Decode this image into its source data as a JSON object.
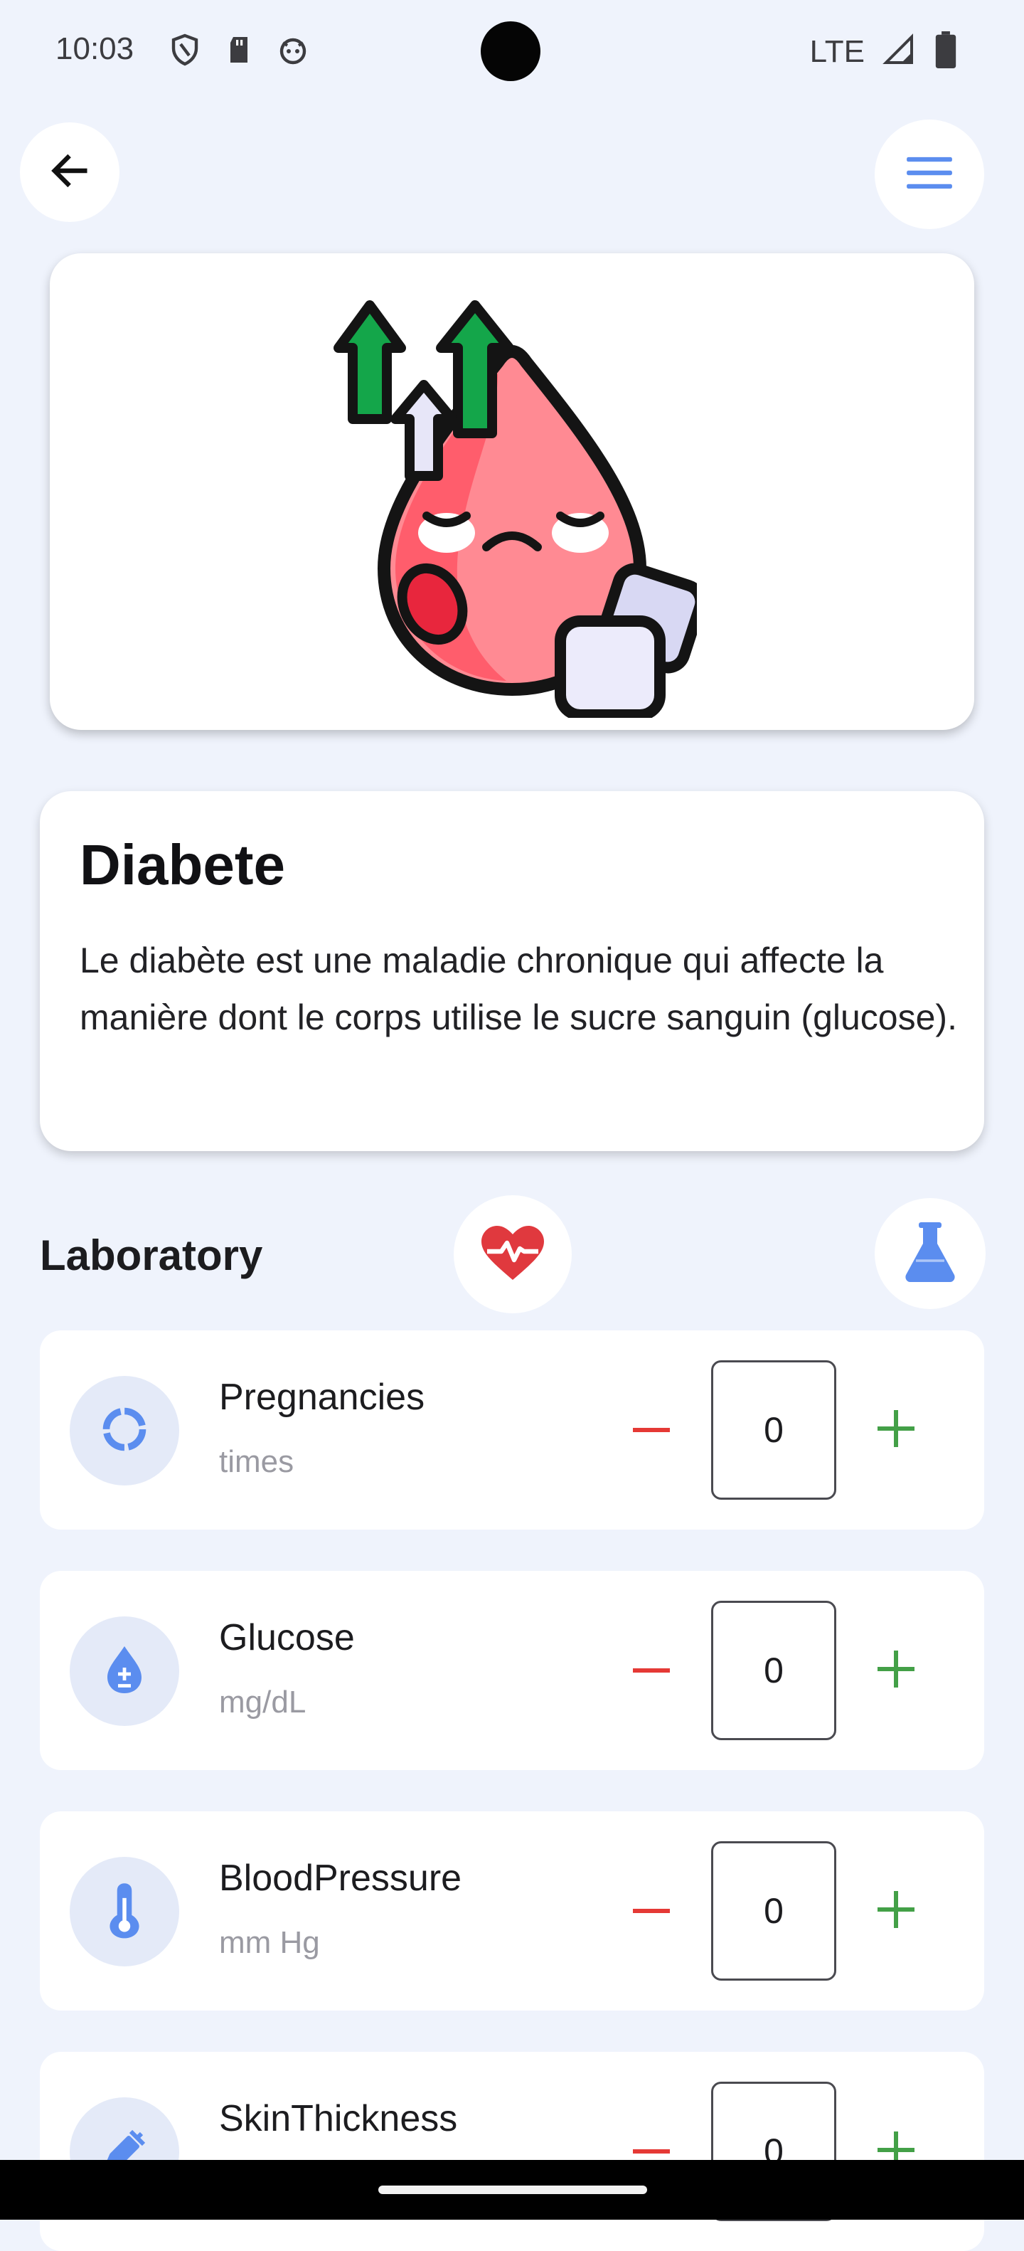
{
  "status_bar": {
    "time": "10:03",
    "network": "LTE",
    "icons": [
      "shield-icon",
      "sd-card-icon",
      "android-icon",
      "signal-icon",
      "battery-icon"
    ]
  },
  "header": {
    "back_icon": "arrow-left-icon",
    "menu_icon": "hamburger-menu-icon"
  },
  "hero": {
    "illustration": "blood-drop-sugar-icon"
  },
  "disease": {
    "title": "Diabete",
    "description": "Le diabète est une maladie chronique qui affecte la manière dont le corps utilise le sucre sanguin (glucose)."
  },
  "laboratory": {
    "title": "Laboratory",
    "heart_icon": "heart-pulse-icon",
    "flask_icon": "flask-icon",
    "items": [
      {
        "name": "Pregnancies",
        "unit": "times",
        "value": "0",
        "icon": "circle-progress-icon"
      },
      {
        "name": "Glucose",
        "unit": "mg/dL",
        "value": "0",
        "icon": "drop-plus-minus-icon"
      },
      {
        "name": "BloodPressure",
        "unit": "mm Hg",
        "value": "0",
        "icon": "thermometer-icon"
      },
      {
        "name": "SkinThickness",
        "unit": "",
        "value": "0",
        "icon": "syringe-icon"
      }
    ]
  },
  "colors": {
    "background": "#eff3fc",
    "accent_blue": "#5b8def",
    "minus_red": "#e53935",
    "plus_green": "#43a047",
    "heart_red": "#e0393e"
  }
}
